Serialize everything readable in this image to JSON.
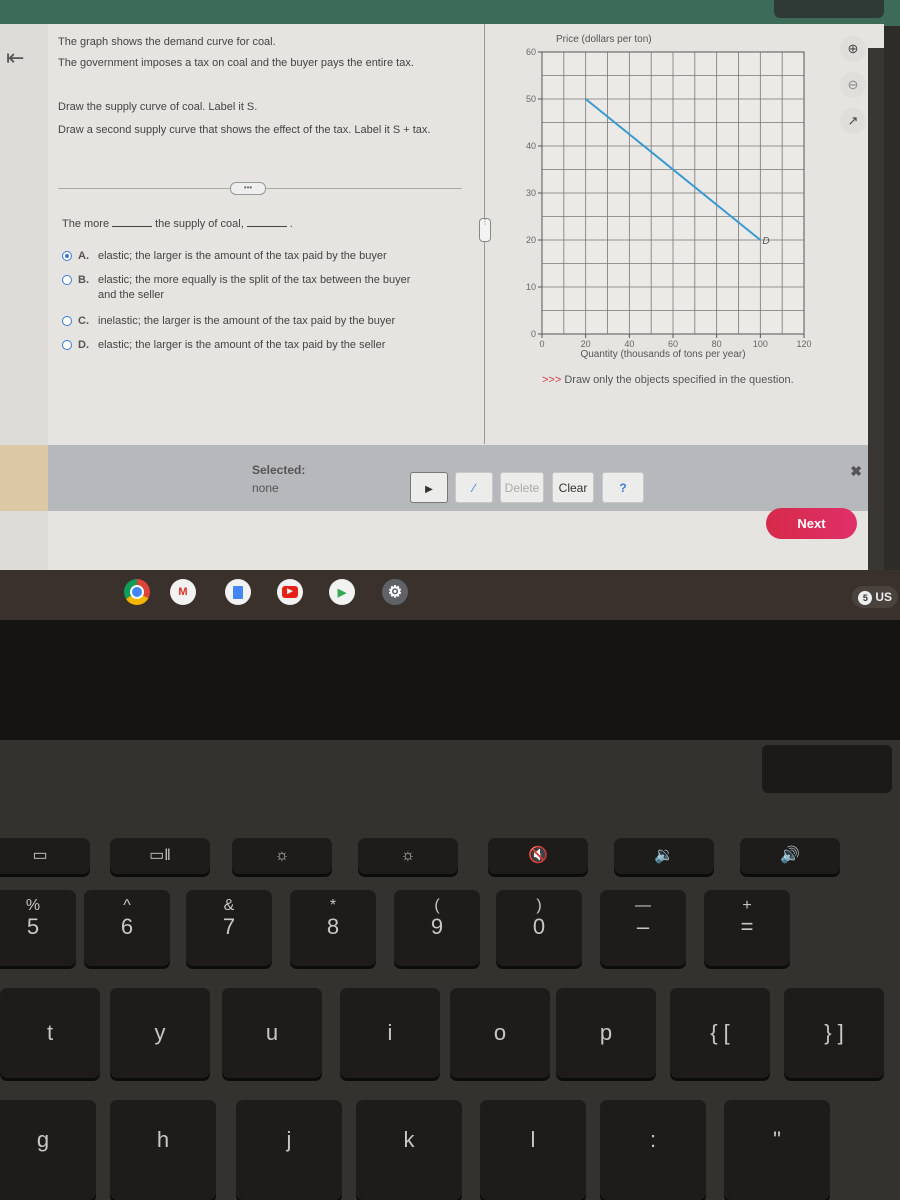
{
  "question": {
    "intro": "The graph shows the demand curve for coal.",
    "scenario": "The government imposes a tax on coal and the buyer pays the entire tax.",
    "task1": "Draw the supply curve of coal. Label it S.",
    "task2": "Draw a second supply curve that shows the effect of the tax. Label it S + tax.",
    "expand_label": "•••",
    "fill_prefix": "The more",
    "fill_middle": "the supply of coal,",
    "fill_suffix": ".",
    "selected_option": "A",
    "options": [
      {
        "letter": "A.",
        "text": "elastic; the larger is the amount of the tax paid by the buyer"
      },
      {
        "letter": "B.",
        "text": "elastic; the more equally is the split of the tax between the buyer and the seller"
      },
      {
        "letter": "C.",
        "text": "inelastic; the larger is the amount of the tax paid by the buyer"
      },
      {
        "letter": "D.",
        "text": "elastic; the larger is the amount of the tax paid by the seller"
      }
    ]
  },
  "chart_data": {
    "type": "line",
    "title": "",
    "ylabel": "Price (dollars per ton)",
    "xlabel": "Quantity (thousands of tons per year)",
    "xlim": [
      0,
      120
    ],
    "ylim": [
      0,
      60
    ],
    "x_ticks": [
      0,
      20,
      40,
      60,
      80,
      100,
      120
    ],
    "y_ticks": [
      0,
      10,
      20,
      30,
      40,
      50,
      60
    ],
    "grid": true,
    "grid_step_x": 10,
    "grid_step_y": 5,
    "series": [
      {
        "name": "D",
        "label": "D",
        "color": "#3a9ad0",
        "points": [
          [
            20,
            50
          ],
          [
            100,
            20
          ]
        ]
      }
    ]
  },
  "hint": {
    "arrows": ">>>",
    "text": "Draw only the objects specified in the question."
  },
  "toolbar": {
    "selected_label": "Selected:",
    "selected_value": "none",
    "pointer_tool": "▶",
    "line_tool": "∕",
    "delete_label": "Delete",
    "clear_label": "Clear",
    "help_label": "?",
    "close_label": "✖"
  },
  "next_label": "Next",
  "side_tools": {
    "zoom_in": "⊕",
    "zoom_out": "⊖",
    "popout": "↗"
  },
  "back_icon": "⇤",
  "shelf": {
    "apps": [
      "chrome",
      "gmail",
      "docs",
      "youtube",
      "play-store",
      "settings"
    ],
    "status_badge": "5",
    "status_lang": "US"
  },
  "keyboard": {
    "function_row": [
      "▭",
      "▭‖",
      "☼",
      "☼",
      "🔇",
      "🔉",
      "🔊"
    ],
    "number_row": [
      {
        "top": "%",
        "bot": "5"
      },
      {
        "top": "^",
        "bot": "6"
      },
      {
        "top": "&",
        "bot": "7"
      },
      {
        "top": "*",
        "bot": "8"
      },
      {
        "top": "(",
        "bot": "9"
      },
      {
        "top": ")",
        "bot": "0"
      },
      {
        "top": "—",
        "bot": "–"
      },
      {
        "top": "+",
        "bot": "="
      }
    ],
    "top_row": [
      "t",
      "y",
      "u",
      "i",
      "o",
      "p",
      "{ [",
      "} ]"
    ],
    "home_row": [
      "g",
      "h",
      "j",
      "k",
      "l",
      ":",
      "\""
    ]
  }
}
